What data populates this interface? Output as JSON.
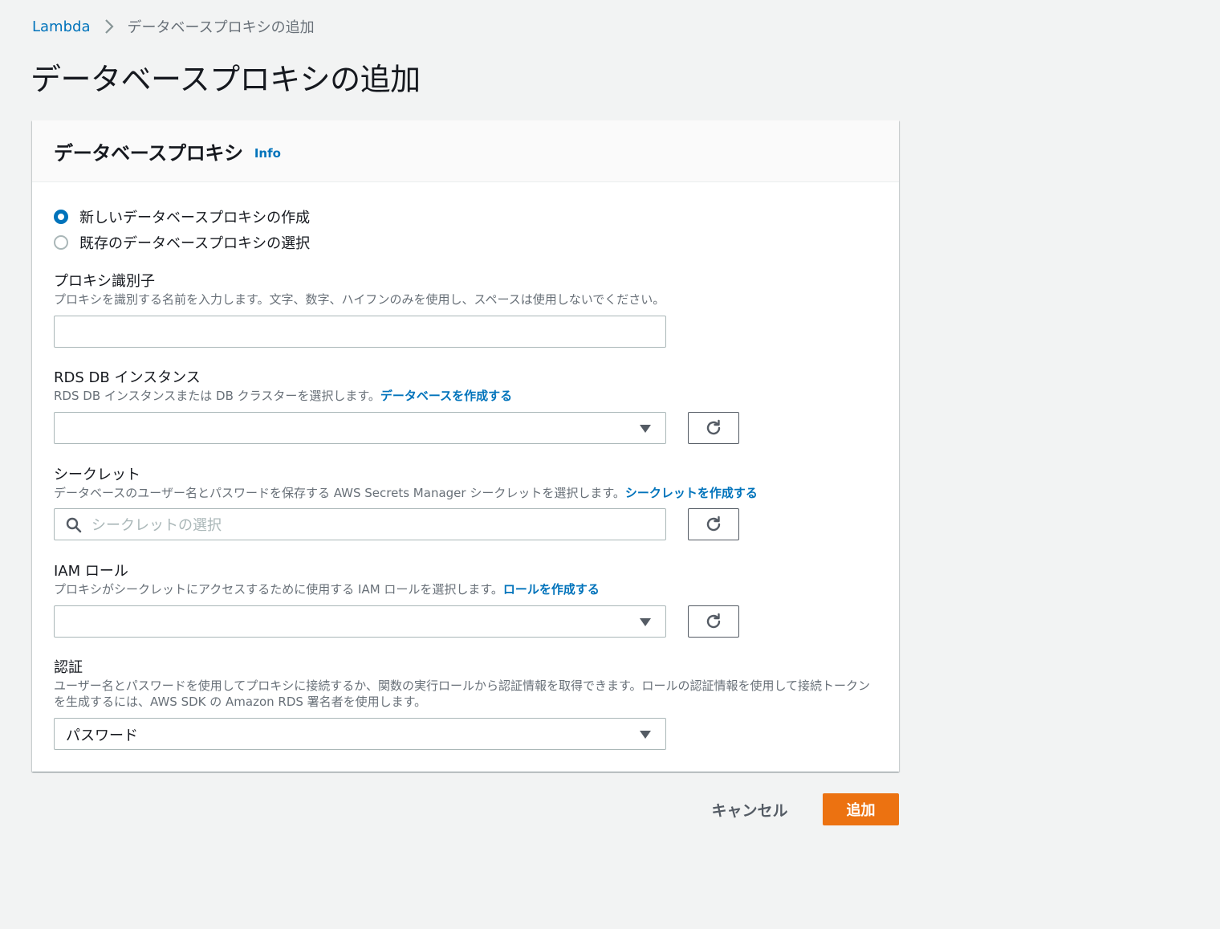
{
  "breadcrumb": {
    "items": [
      {
        "label": "Lambda"
      },
      {
        "label": "データベースプロキシの追加"
      }
    ]
  },
  "page": {
    "title": "データベースプロキシの追加"
  },
  "panel": {
    "title": "データベースプロキシ",
    "info_label": "Info",
    "radio_options": [
      {
        "label": "新しいデータベースプロキシの作成",
        "checked": true
      },
      {
        "label": "既存のデータベースプロキシの選択",
        "checked": false
      }
    ],
    "proxy_identifier": {
      "label": "プロキシ識別子",
      "description": "プロキシを識別する名前を入力します。文字、数字、ハイフンのみを使用し、スペースは使用しないでください。",
      "value": ""
    },
    "rds_instance": {
      "label": "RDS DB インスタンス",
      "description": "RDS DB インスタンスまたは DB クラスターを選択します。",
      "link": "データベースを作成する",
      "value": ""
    },
    "secret": {
      "label": "シークレット",
      "description": "データベースのユーザー名とパスワードを保存する AWS Secrets Manager シークレットを選択します。",
      "link": "シークレットを作成する",
      "placeholder": "シークレットの選択"
    },
    "iam_role": {
      "label": "IAM ロール",
      "description": "プロキシがシークレットにアクセスするために使用する IAM ロールを選択します。",
      "link": "ロールを作成する",
      "value": ""
    },
    "auth": {
      "label": "認証",
      "description": "ユーザー名とパスワードを使用してプロキシに接続するか、関数の実行ロールから認証情報を取得できます。ロールの認証情報を使用して接続トークンを生成するには、AWS SDK の Amazon RDS 署名者を使用します。",
      "value": "パスワード"
    }
  },
  "actions": {
    "cancel_label": "キャンセル",
    "add_label": "追加"
  },
  "colors": {
    "link": "#0073bb",
    "primary": "#ec7211",
    "background": "#f2f3f3"
  }
}
